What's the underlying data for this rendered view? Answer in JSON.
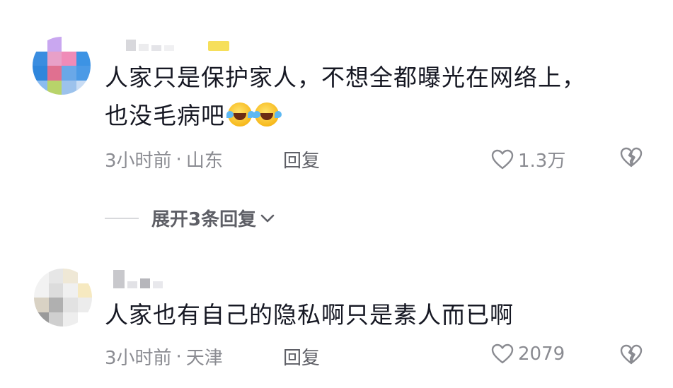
{
  "comments": [
    {
      "text_line1": "人家只是保护家人，不想全都曝光在网络上，",
      "text_line2": "也没毛病吧",
      "emojis": [
        "laugh-cry-emoji",
        "laugh-cry-emoji"
      ],
      "time": "3小时前",
      "separator": "·",
      "location": "山东",
      "reply_label": "回复",
      "likes": "1.3万"
    },
    {
      "text_line1": "人家也有自己的隐私啊只是素人而已啊",
      "time": "3小时前",
      "separator": "·",
      "location": "天津",
      "reply_label": "回复",
      "likes": "2079"
    }
  ],
  "expand_replies": {
    "label": "展开3条回复"
  },
  "colors": {
    "text": "#161823",
    "meta": "#8a8b91",
    "action": "#5e5f66",
    "badge": "#f6df5b"
  }
}
